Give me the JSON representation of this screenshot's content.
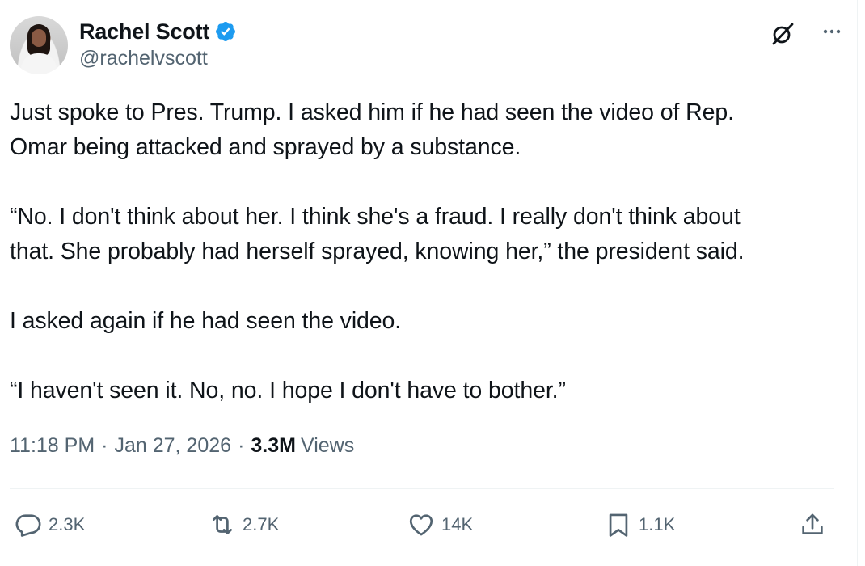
{
  "author": {
    "display_name": "Rachel Scott",
    "handle": "@rachelvscott",
    "verified": true,
    "verified_color": "#1d9bf0"
  },
  "icons": {
    "header_right": [
      "grok-icon",
      "more-icon"
    ]
  },
  "tweet": {
    "paragraphs": [
      "Just spoke to Pres. Trump. I asked him if he had seen the video of Rep.\nOmar being attacked and sprayed by a substance.",
      "“No. I don't think about her. I think she's a fraud. I really don't think about\nthat. She probably had herself sprayed, knowing her,” the president said.",
      "I asked again if he had seen the video.",
      "“I haven't seen it. No, no. I hope I don't have to bother.”"
    ]
  },
  "meta": {
    "time": "11:18 PM",
    "date": "Jan 27, 2026",
    "views_count": "3.3M",
    "views_label": "Views"
  },
  "actions": {
    "replies": "2.3K",
    "reposts": "2.7K",
    "likes": "14K",
    "bookmarks": "1.1K"
  }
}
